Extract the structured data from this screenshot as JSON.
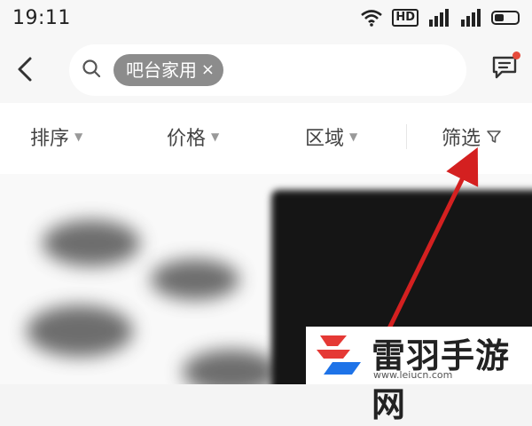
{
  "status_bar": {
    "time": "19:11",
    "icons": [
      "wifi-icon",
      "hd-icon",
      "signal-icon",
      "signal-icon",
      "battery-icon"
    ],
    "hd_label": "HD"
  },
  "header": {
    "back_icon": "chevron-left-icon",
    "search_icon": "search-icon",
    "search_tag": "吧台家用",
    "tag_close": "×",
    "message_icon": "message-icon"
  },
  "filters": {
    "sort": "排序",
    "price": "价格",
    "area": "区域",
    "filter": "筛选"
  },
  "watermark": {
    "title": "雷羽手游网",
    "url": "www.leiucn.com"
  },
  "colors": {
    "arrow": "#d42020",
    "accent_dot": "#e64a3b",
    "logo_red": "#e53935",
    "logo_blue": "#1e73e8"
  }
}
